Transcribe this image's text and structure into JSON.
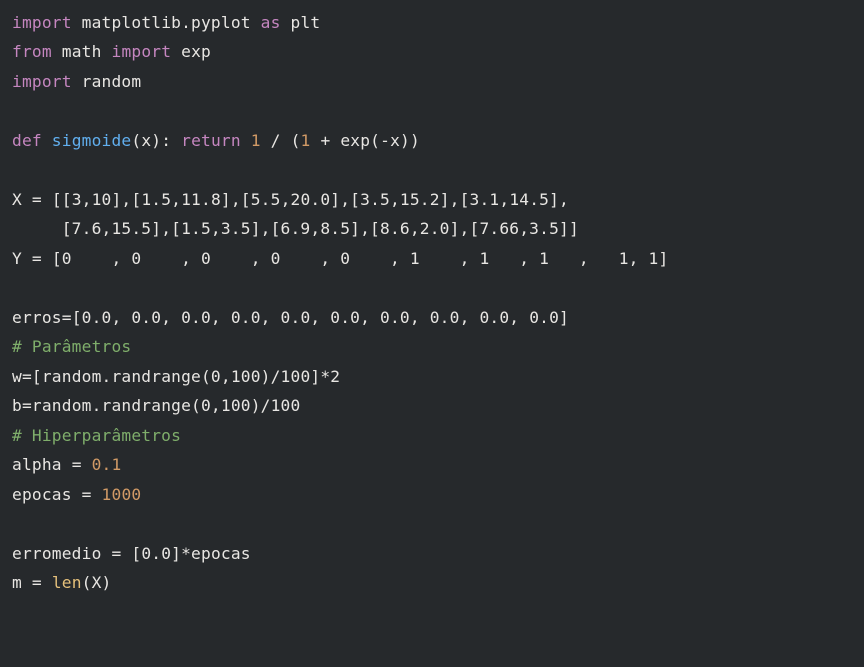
{
  "code": {
    "line1": {
      "kw_import": "import",
      "mod": "matplotlib.pyplot",
      "kw_as": "as",
      "alias": "plt"
    },
    "line2": {
      "kw_from": "from",
      "mod": "math",
      "kw_import": "import",
      "name": "exp"
    },
    "line3": {
      "kw_import": "import",
      "mod": "random"
    },
    "line5": {
      "kw_def": "def",
      "name": "sigmoide",
      "params": "(x):",
      "kw_return": "return",
      "expr_1": "1",
      "expr_div": "/",
      "expr_open": "(",
      "expr_1b": "1",
      "expr_plus": "+",
      "expr_exp": "exp(",
      "expr_neg": "-",
      "expr_x": "x",
      "expr_close": "))"
    },
    "line7": {
      "lhs": "X",
      "eq": "=",
      "rhs": "[[3,10],[1.5,11.8],[5.5,20.0],[3.5,15.2],[3.1,14.5],"
    },
    "line8": {
      "indent": "     ",
      "rhs": "[7.6,15.5],[1.5,3.5],[6.9,8.5],[8.6,2.0],[7.66,3.5]]"
    },
    "line9": {
      "lhs": "Y",
      "eq": "=",
      "rhs": "[0    , 0    , 0    , 0    , 0    , 1    , 1   , 1   ,   1, 1]"
    },
    "line11": {
      "lhs": "erros",
      "eq": "=",
      "rhs": "[0.0, 0.0, 0.0, 0.0, 0.0, 0.0, 0.0, 0.0, 0.0, 0.0]"
    },
    "line12": {
      "comment": "# Parâmetros"
    },
    "line13": {
      "lhs": "w",
      "eq": "=",
      "rhs": "[random.randrange(0,100)/100]*2"
    },
    "line14": {
      "lhs": "b",
      "eq": "=",
      "rhs": "random.randrange(0,100)/100"
    },
    "line15": {
      "comment": "# Hiperparâmetros"
    },
    "line16": {
      "lhs": "alpha",
      "eq": "=",
      "rhs": "0.1"
    },
    "line17": {
      "lhs": "epocas",
      "eq": "=",
      "rhs": "1000"
    },
    "line19": {
      "lhs": "erromedio",
      "eq": "=",
      "rhs": "[0.0]*epocas"
    },
    "line20": {
      "lhs": "m",
      "eq": "=",
      "rhs_call": "len",
      "rhs_arg": "(X)"
    }
  }
}
